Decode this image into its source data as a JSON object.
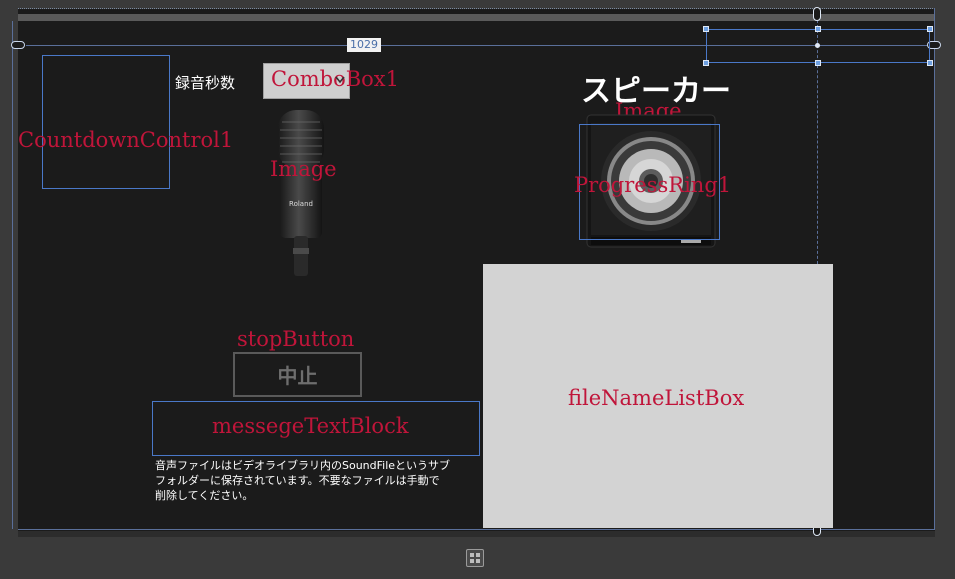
{
  "designer": {
    "width_readout": "1029"
  },
  "countdown": {
    "label": "CountdownControl1"
  },
  "recording": {
    "seconds_label": "録音秒数",
    "combo_label": "ComboBox1"
  },
  "mic": {
    "label": "Image"
  },
  "speaker": {
    "title": "スピーカー",
    "image_label": "Image",
    "progress_label": "ProgressRing1"
  },
  "stop": {
    "control_label": "stopButton",
    "button_text": "中止"
  },
  "message": {
    "control_label": "messegeTextBlock",
    "info_text": [
      "音声ファイルはビデオライブラリ内のSoundFileというサブ",
      "フォルダーに保存されています。不要なファイルは手動で",
      "削除してください。"
    ]
  },
  "filelist": {
    "label": "fileNameListBox"
  },
  "colors": {
    "canvas": "#1b1b1b",
    "selection": "#4a78c8",
    "control_label": "#c0153a",
    "listbox": "#d3d3d3"
  }
}
